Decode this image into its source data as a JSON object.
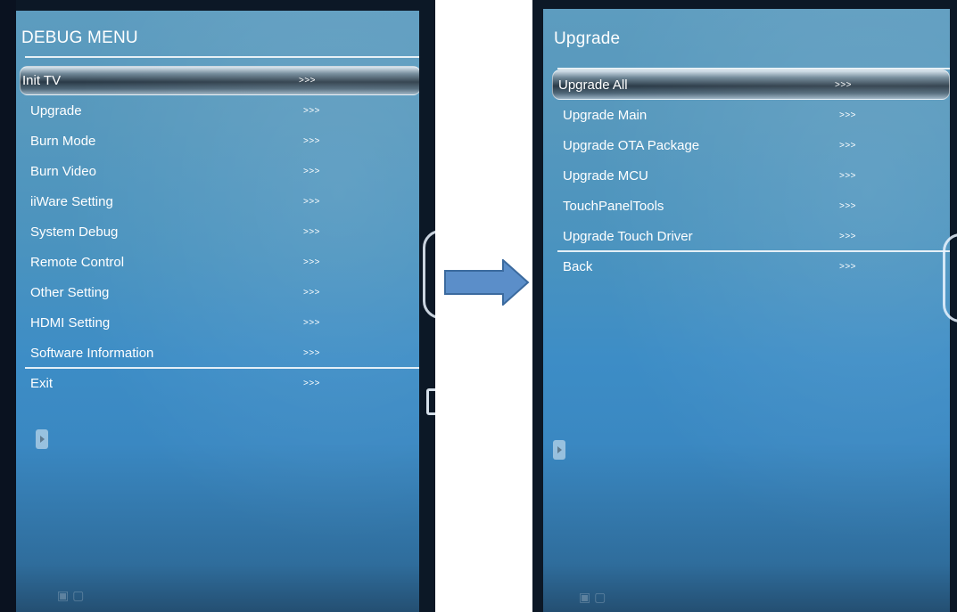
{
  "left_screen": {
    "title": "DEBUG MENU",
    "items": [
      {
        "label": "Init TV",
        "arrow": ">>>",
        "selected": true
      },
      {
        "label": "Upgrade",
        "arrow": ">>>"
      },
      {
        "label": "Burn Mode",
        "arrow": ">>>"
      },
      {
        "label": "Burn Video",
        "arrow": ">>>"
      },
      {
        "label": "iiWare Setting",
        "arrow": ">>>"
      },
      {
        "label": "System Debug",
        "arrow": ">>>"
      },
      {
        "label": "Remote Control",
        "arrow": ">>>"
      },
      {
        "label": "Other Setting",
        "arrow": ">>>"
      },
      {
        "label": "HDMI Setting",
        "arrow": ">>>"
      },
      {
        "label": "Software Information",
        "arrow": ">>>"
      },
      {
        "label": "Exit",
        "arrow": ">>>"
      }
    ]
  },
  "right_screen": {
    "title": "Upgrade",
    "items": [
      {
        "label": "Upgrade All",
        "arrow": ">>>",
        "selected": true
      },
      {
        "label": "Upgrade Main",
        "arrow": ">>>"
      },
      {
        "label": "Upgrade OTA Package",
        "arrow": ">>>"
      },
      {
        "label": "Upgrade MCU",
        "arrow": ">>>"
      },
      {
        "label": "TouchPanelTools",
        "arrow": ">>>"
      },
      {
        "label": "Upgrade Touch Driver",
        "arrow": ">>>"
      },
      {
        "label": "Back",
        "arrow": ">>>"
      }
    ]
  },
  "colors": {
    "screen_blue": "#4a93bf",
    "arrow_fill": "#5b8ec9",
    "arrow_stroke": "#3b6a9e",
    "text": "#ffffff"
  },
  "icons": {
    "scroll_handle": "play-triangle-icon",
    "connector": "right-arrow-icon"
  }
}
